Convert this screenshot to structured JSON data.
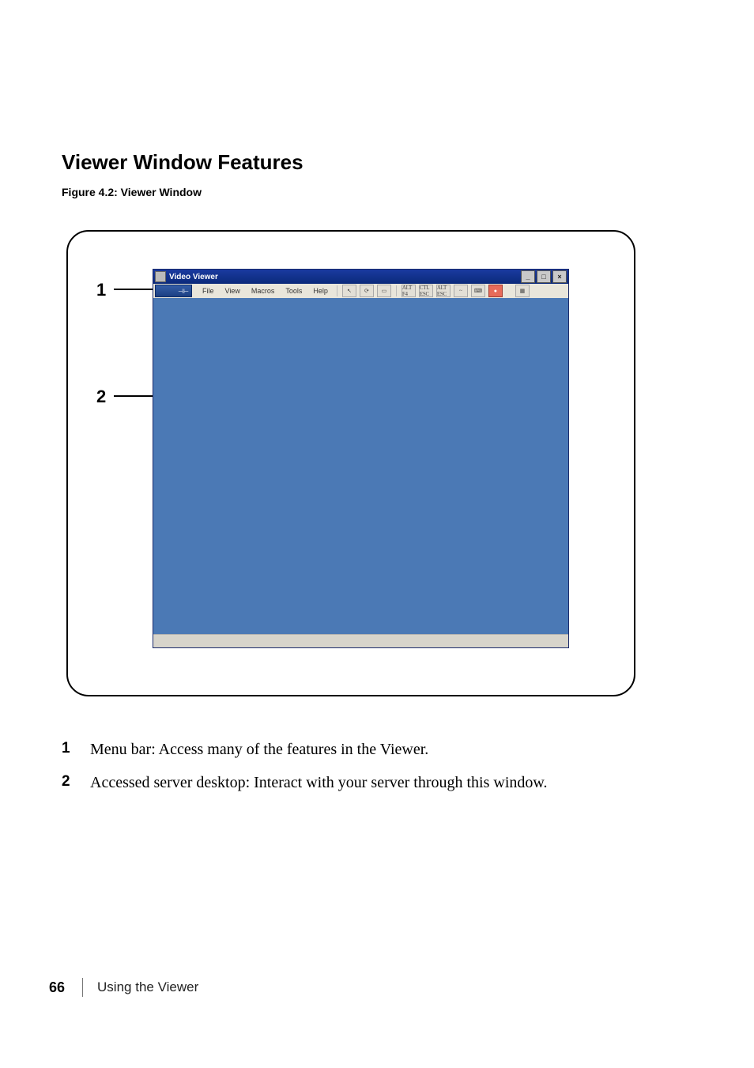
{
  "section_title": "Viewer Window Features",
  "figure_caption": "Figure 4.2: Viewer Window",
  "callouts": {
    "one": "1",
    "two": "2"
  },
  "viewer": {
    "title": "Video Viewer",
    "menu": {
      "file": "File",
      "view": "View",
      "macros": "Macros",
      "tools": "Tools",
      "help": "Help"
    },
    "toolbar": {
      "altf4": "ALT F4",
      "ctrlesc": "CTL ESC",
      "altesc": "ALT ESC",
      "tilde": "~"
    },
    "window_controls": {
      "min": "_",
      "max": "□",
      "close": "×"
    }
  },
  "legend": {
    "r1n": "1",
    "r1t": "Menu bar: Access many of the features in the Viewer.",
    "r2n": "2",
    "r2t": "Accessed server desktop: Interact with your server through this window."
  },
  "footer": {
    "page": "66",
    "chapter": "Using the Viewer"
  }
}
